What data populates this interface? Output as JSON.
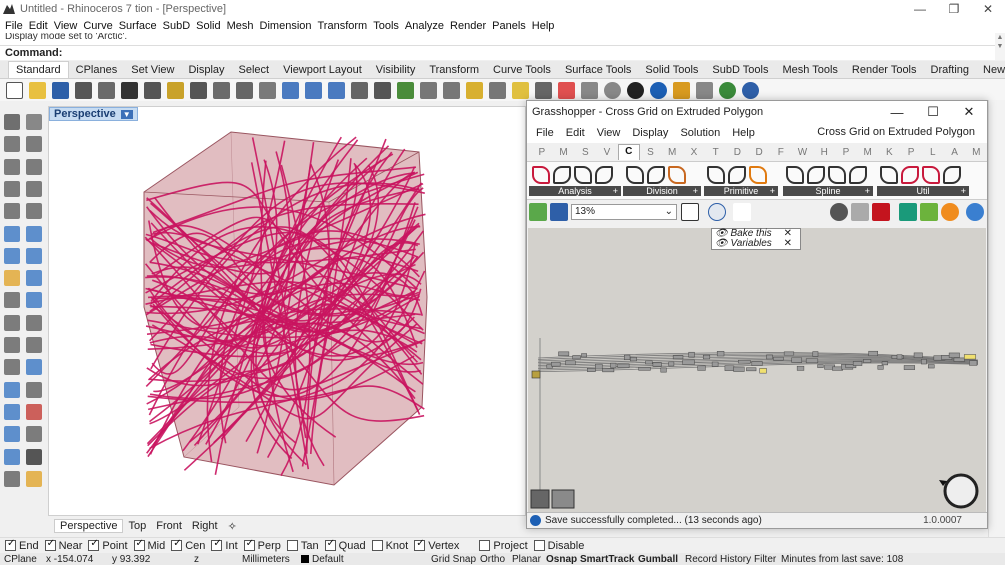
{
  "window": {
    "title": "Untitled - Rhinoceros 7 tion - [Perspective]",
    "controls": [
      "—",
      "❐",
      "✕"
    ]
  },
  "menu": [
    "File",
    "Edit",
    "View",
    "Curve",
    "Surface",
    "SubD",
    "Solid",
    "Mesh",
    "Dimension",
    "Transform",
    "Tools",
    "Analyze",
    "Render",
    "Panels",
    "Help"
  ],
  "command": {
    "history": "Display mode set to 'Arctic'.",
    "prompt": "Command:"
  },
  "toolbar_tabs": [
    "Standard",
    "CPlanes",
    "Set View",
    "Display",
    "Select",
    "Viewport Layout",
    "Visibility",
    "Transform",
    "Curve Tools",
    "Surface Tools",
    "Solid Tools",
    "SubD Tools",
    "Mesh Tools",
    "Render Tools",
    "Drafting",
    "New in V>"
  ],
  "toolbar_icons": [
    "new-icon",
    "open-icon",
    "save-icon",
    "print-icon",
    "import-icon",
    "cut-icon",
    "copy-icon",
    "paste-icon",
    "undo-icon",
    "pan-icon",
    "move-view-icon",
    "zoom-icon",
    "zoom-window-icon",
    "zoom-extents-icon",
    "zoom-selected-icon",
    "rotate-view-icon",
    "four-view-icon",
    "cplane-icon",
    "named-view-icon",
    "tools-icon",
    "perspective-icon",
    "object-props-icon",
    "light-icon",
    "osnap-icon",
    "materials-icon",
    "render-icon",
    "sphere-icon",
    "material-icon",
    "texture-icon",
    "env-icon",
    "gear-icon",
    "grasshopper-icon",
    "help-icon"
  ],
  "viewport": {
    "label": "Perspective"
  },
  "viewport_tabs": [
    "Perspective",
    "Top",
    "Front",
    "Right"
  ],
  "osnaps": [
    {
      "label": "End",
      "on": true
    },
    {
      "label": "Near",
      "on": true
    },
    {
      "label": "Point",
      "on": true
    },
    {
      "label": "Mid",
      "on": true
    },
    {
      "label": "Cen",
      "on": true
    },
    {
      "label": "Int",
      "on": true
    },
    {
      "label": "Perp",
      "on": true
    },
    {
      "label": "Tan",
      "on": false
    },
    {
      "label": "Quad",
      "on": true
    },
    {
      "label": "Knot",
      "on": false
    },
    {
      "label": "Vertex",
      "on": true
    },
    {
      "label": "Project",
      "on": false
    },
    {
      "label": "Disable",
      "on": false
    }
  ],
  "status": {
    "cplane": "CPlane",
    "x": "x -154.074",
    "y": "y 93.392",
    "z": "z",
    "units": "Millimeters",
    "layer": "Default",
    "grid_snap": "Grid Snap",
    "ortho": "Ortho",
    "planar": "Planar",
    "osnap": "Osnap",
    "smarttrack": "SmartTrack",
    "gumball": "Gumball",
    "record": "Record History",
    "filter": "Filter",
    "minutes": "Minutes from last save: 108"
  },
  "grasshopper": {
    "title": "Grasshopper - Cross Grid on Extruded Polygon",
    "menu": [
      "File",
      "Edit",
      "View",
      "Display",
      "Solution",
      "Help"
    ],
    "document": "Cross Grid on Extruded Polygon",
    "categories": [
      "P",
      "M",
      "S",
      "V",
      "C",
      "S",
      "M",
      "X",
      "T",
      "D",
      "D",
      "F",
      "W",
      "H",
      "P",
      "M",
      "K",
      "P",
      "L",
      "A",
      "M"
    ],
    "groups": [
      {
        "label": "Analysis",
        "icons": [
          "analysis-icon",
          "curve-closest-icon",
          "curve-length-icon",
          "polygon-center-icon"
        ]
      },
      {
        "label": "Division",
        "icons": [
          "divide-icon",
          "shatter-icon",
          "contour-icon"
        ]
      },
      {
        "label": "Primitive",
        "icons": [
          "line-icon",
          "line-sdl-icon",
          "circle-icon"
        ]
      },
      {
        "label": "Spline",
        "icons": [
          "interpolate-icon",
          "nurbs-icon",
          "polyline-icon",
          "bezier-icon"
        ]
      },
      {
        "label": "Util",
        "icons": [
          "offset-icon",
          "fillet-icon",
          "join-icon",
          "explode-icon"
        ]
      }
    ],
    "zoom": "13%",
    "bake_menu": [
      "Bake this",
      "Variables"
    ],
    "status": "Save successfully completed... (13 seconds ago)",
    "version": "1.0.0007"
  },
  "colors": {
    "accent": "#1c5fb4",
    "geometry": "#c9145f",
    "hull": "#c8868e",
    "gh_canvas": "#d3d1cc"
  }
}
